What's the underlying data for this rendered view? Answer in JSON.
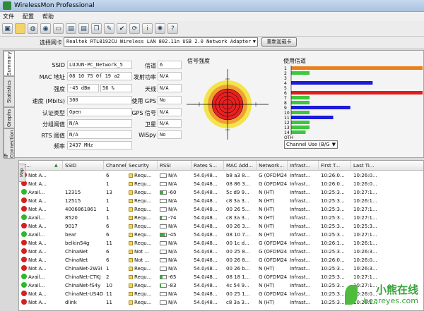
{
  "window": {
    "title": "WirelessMon Professional"
  },
  "menu": [
    "文件",
    "配置",
    "帮助"
  ],
  "toolbar_icons": [
    "save-icon",
    "folder-icon",
    "database-icon",
    "globe-icon",
    "computer-icon",
    "printer-icon",
    "printer-icon",
    "copy-icon",
    "notes-icon",
    "check-icon",
    "refresh-icon",
    "info-icon",
    "spinner-icon",
    "help-icon"
  ],
  "adapter": {
    "label": "选择网卡",
    "value": "Realtek RTL8192CU Wireless LAN 802.11n USB 2.0 Network Adapter",
    "reload": "重新加载卡"
  },
  "side_tabs": [
    "Summary",
    "Statistics",
    "Graphs",
    "IP Connection",
    "Map"
  ],
  "summary": {
    "ssid_label": "SSID",
    "ssid": "LUJUN-PC_Network_5",
    "mac_label": "MAC 地址",
    "mac": "08 10 75 0f 19 a2",
    "strength_label": "强度",
    "strength_dbm": "-45 dBm",
    "strength_pct": "56 %",
    "speed_label": "速度 (Mbits)",
    "speed": "300",
    "auth_label": "认证类型",
    "auth": "Open",
    "cipher_label": "分组阈值",
    "cipher": "N/A",
    "rts_label": "RTS 阈值",
    "rts": "N/A",
    "freq_label": "频率",
    "freq": "2437 MHz",
    "channel_label": "信道",
    "channel": "6",
    "txpower_label": "发射功率",
    "txpower": "N/A",
    "antenna_label": "天线",
    "antenna": "N/A",
    "gps_label": "使用 GPS",
    "gps": "No",
    "gpssig_label": "GPS 信号",
    "gpssig": "N/A",
    "sat_label": "卫星",
    "sat": "N/A",
    "wispy_label": "WiSpy",
    "wispy": "No"
  },
  "signal_title": "信号强度",
  "channel_title": "使用信道",
  "channel_select": "Channel Use (B/G",
  "channel_caption": "OTH",
  "chart_data": {
    "type": "bar",
    "categories": [
      "1",
      "2",
      "3",
      "4",
      "5",
      "6",
      "7",
      "8",
      "9",
      "10",
      "11",
      "12",
      "13",
      "14"
    ],
    "series": [
      {
        "values": [
          1.0,
          0.14,
          0,
          0.62,
          0,
          1.0,
          0.14,
          0.14,
          0.45,
          0.14,
          0.32,
          0.14,
          0.14,
          0.11
        ]
      }
    ],
    "colors": [
      "#e8801c",
      "#3ec63e",
      "#ffffff",
      "#1b1bd9",
      "#3ec63e",
      "#e01c1c",
      "#3ec63e",
      "#3ec63e",
      "#1b1bd9",
      "#3ec63e",
      "#1b1bd9",
      "#3ec63e",
      "#3ec63e",
      "#3ec63e"
    ],
    "title": "使用信道",
    "xlim": [
      0,
      1
    ]
  },
  "table": {
    "columns": [
      "St...",
      "SSID",
      "Channel",
      "Security",
      "RSSI",
      "Rates S...",
      "MAC Add...",
      "Network...",
      "Infrast...",
      "First T...",
      "Last Ti..."
    ],
    "rows": [
      {
        "status": "red",
        "state": "Not A...",
        "ssid": "",
        "channel": "6",
        "security": "Requ...",
        "rssi": "N/A",
        "rssi_level": 0,
        "rates": "54.0/48...",
        "mac": "b8 a3 8...",
        "network": "G (OFDM24)",
        "infra": "Infrast...",
        "first": "10:26:0...",
        "last": "10:26:0..."
      },
      {
        "status": "red",
        "state": "Not A...",
        "ssid": "",
        "channel": "1",
        "security": "Requ...",
        "rssi": "N/A",
        "rssi_level": 0,
        "rates": "54.0/48...",
        "mac": "08 86 3...",
        "network": "G (OFDM24)",
        "infra": "Infrast...",
        "first": "10:26:0...",
        "last": "10:26:0..."
      },
      {
        "status": "green",
        "state": "Avail...",
        "ssid": "12315",
        "channel": "13",
        "security": "Requ...",
        "rssi": "-60",
        "rssi_level": 0.5,
        "rates": "54.0/48...",
        "mac": "5c d9 9...",
        "network": "N (HT)",
        "infra": "Infrast...",
        "first": "10:25:3...",
        "last": "10:27:1..."
      },
      {
        "status": "red",
        "state": "Not A...",
        "ssid": "12515",
        "channel": "1",
        "security": "Requ...",
        "rssi": "N/A",
        "rssi_level": 0,
        "rates": "54.0/48...",
        "mac": "c8 3a 3...",
        "network": "N (HT)",
        "infra": "Infrast...",
        "first": "10:25:3...",
        "last": "10:26:1..."
      },
      {
        "status": "red",
        "state": "Not A...",
        "ssid": "4006861861",
        "channel": "1",
        "security": "Requ...",
        "rssi": "N/A",
        "rssi_level": 0,
        "rates": "54.0/48...",
        "mac": "00 26 5...",
        "network": "N (HT)",
        "infra": "Infrast...",
        "first": "10:25:3...",
        "last": "10:27:1..."
      },
      {
        "status": "green",
        "state": "Avail...",
        "ssid": "8520",
        "channel": "1",
        "security": "Requ...",
        "rssi": "-74",
        "rssi_level": 0.2,
        "rates": "54.0/48...",
        "mac": "c8 3a 3...",
        "network": "N (HT)",
        "infra": "Infrast...",
        "first": "10:25:3...",
        "last": "10:27:1..."
      },
      {
        "status": "red",
        "state": "Not A...",
        "ssid": "9017",
        "channel": "6",
        "security": "Requ...",
        "rssi": "N/A",
        "rssi_level": 0,
        "rates": "54.0/48...",
        "mac": "00 26 3...",
        "network": "N (HT)",
        "infra": "Infrast...",
        "first": "10:25:3...",
        "last": "10:25:3..."
      },
      {
        "status": "green",
        "state": "Avail...",
        "ssid": "bear",
        "channel": "6",
        "security": "Requ...",
        "rssi": "-45",
        "rssi_level": 0.8,
        "rates": "54.0/48...",
        "mac": "08 10 7...",
        "network": "N (HT)",
        "infra": "Infrast...",
        "first": "10:25:3...",
        "last": "10:27:1..."
      },
      {
        "status": "red",
        "state": "Not A...",
        "ssid": "belkin54g",
        "channel": "11",
        "security": "Requ...",
        "rssi": "N/A",
        "rssi_level": 0,
        "rates": "54.0/48...",
        "mac": "00 1c d...",
        "network": "G (OFDM24)",
        "infra": "Infrast...",
        "first": "10:26:1...",
        "last": "10:26:1..."
      },
      {
        "status": "red",
        "state": "Not A...",
        "ssid": "ChinaNet",
        "channel": "6",
        "security": "Not ...",
        "rssi": "N/A",
        "rssi_level": 0,
        "rates": "54.0/48...",
        "mac": "00 25 8...",
        "network": "G (OFDM24)",
        "infra": "Infrast...",
        "first": "10:25:3...",
        "last": "10:26:3..."
      },
      {
        "status": "red",
        "state": "Not A...",
        "ssid": "ChinaNet",
        "channel": "6",
        "security": "Not ...",
        "rssi": "N/A",
        "rssi_level": 0,
        "rates": "54.0/48...",
        "mac": "00 26 8...",
        "network": "G (OFDM24)",
        "infra": "Infrast...",
        "first": "10:26:0...",
        "last": "10:26:0..."
      },
      {
        "status": "red",
        "state": "Not A...",
        "ssid": "ChinaNet-2W3i",
        "channel": "1",
        "security": "Requ...",
        "rssi": "N/A",
        "rssi_level": 0,
        "rates": "54.0/48...",
        "mac": "00 26 b...",
        "network": "N (HT)",
        "infra": "Infrast...",
        "first": "10:25:3...",
        "last": "10:26:3..."
      },
      {
        "status": "green",
        "state": "Avail...",
        "ssid": "ChinaNet-CTKJ",
        "channel": "2",
        "security": "Requ...",
        "rssi": "-65",
        "rssi_level": 0.4,
        "rates": "54.0/48...",
        "mac": "08 18 1...",
        "network": "G (OFDM24)",
        "infra": "Infrast...",
        "first": "10:25:3...",
        "last": "10:27:1..."
      },
      {
        "status": "green",
        "state": "Avail...",
        "ssid": "ChinaNet-fS4y",
        "channel": "10",
        "security": "Requ...",
        "rssi": "-83",
        "rssi_level": 0.1,
        "rates": "54.0/48...",
        "mac": "4c 54 9...",
        "network": "N (HT)",
        "infra": "Infrast...",
        "first": "10:25:3...",
        "last": "10:27:1..."
      },
      {
        "status": "red",
        "state": "Not A...",
        "ssid": "ChinaNet-US4D",
        "channel": "11",
        "security": "Requ...",
        "rssi": "N/A",
        "rssi_level": 0,
        "rates": "54.0/48...",
        "mac": "00 25 1...",
        "network": "G (OFDM24)",
        "infra": "Infrast...",
        "first": "10:25:3...",
        "last": "10:26:0..."
      },
      {
        "status": "red",
        "state": "Not A...",
        "ssid": "dlink",
        "channel": "11",
        "security": "Requ...",
        "rssi": "N/A",
        "rssi_level": 0,
        "rates": "54.0/48...",
        "mac": "c8 3a 3...",
        "network": "N (HT)",
        "infra": "Infrast...",
        "first": "10:25:3...",
        "last": "10:26:1..."
      }
    ]
  },
  "watermark": {
    "line1": "小熊在线",
    "line2": "beareyes.com"
  },
  "colors": {
    "titlebar": "#b7cde8",
    "green": "#2db82d",
    "red": "#d62020"
  }
}
